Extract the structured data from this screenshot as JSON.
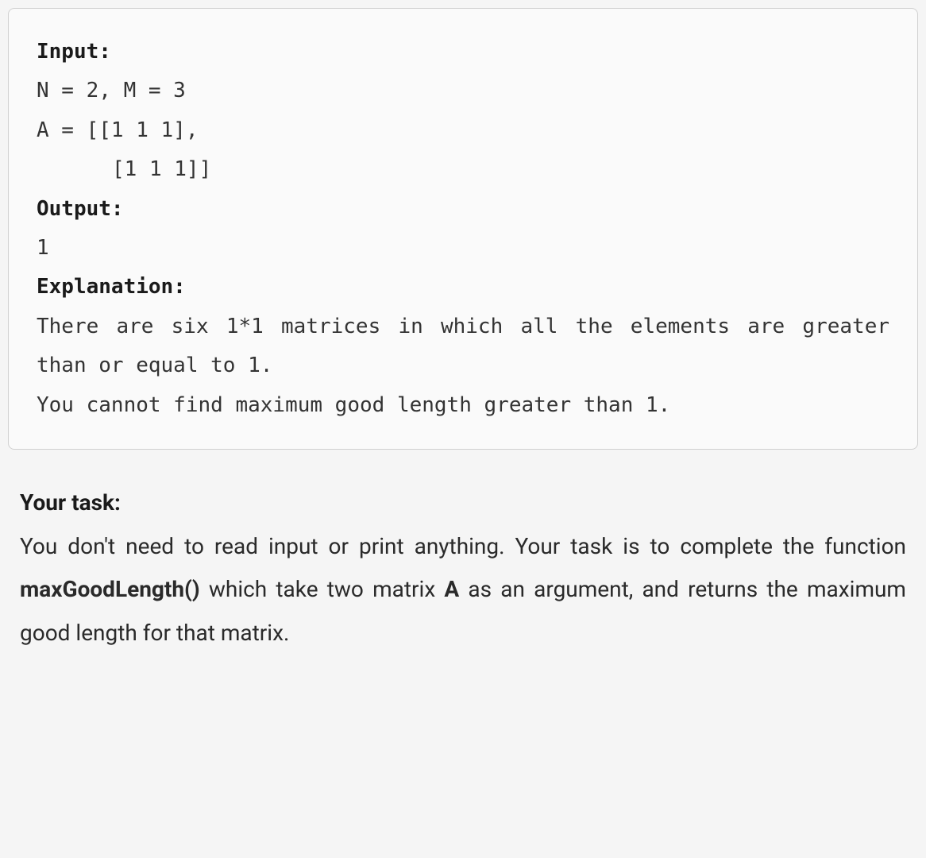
{
  "example": {
    "input_label": "Input:",
    "input_line1": "N = 2, M = 3",
    "input_line2": "A = [[1 1 1],",
    "input_line3": "[1 1 1]]",
    "output_label": "Output:",
    "output_value": "1",
    "explanation_label": "Explanation:",
    "explanation_line1": "There are six 1*1 matrices in which all the elements are greater than or equal to 1.",
    "explanation_line2": "You cannot find maximum good length greater than 1."
  },
  "task": {
    "label": "Your task:",
    "text_before": "You don't need to read input or print anything. Your task is to complete the function ",
    "function_name": "maxGoodLength()",
    "text_mid": " which take two matrix ",
    "matrix_name": "A",
    "text_after": " as an argument, and returns the maximum good length for that matrix."
  }
}
